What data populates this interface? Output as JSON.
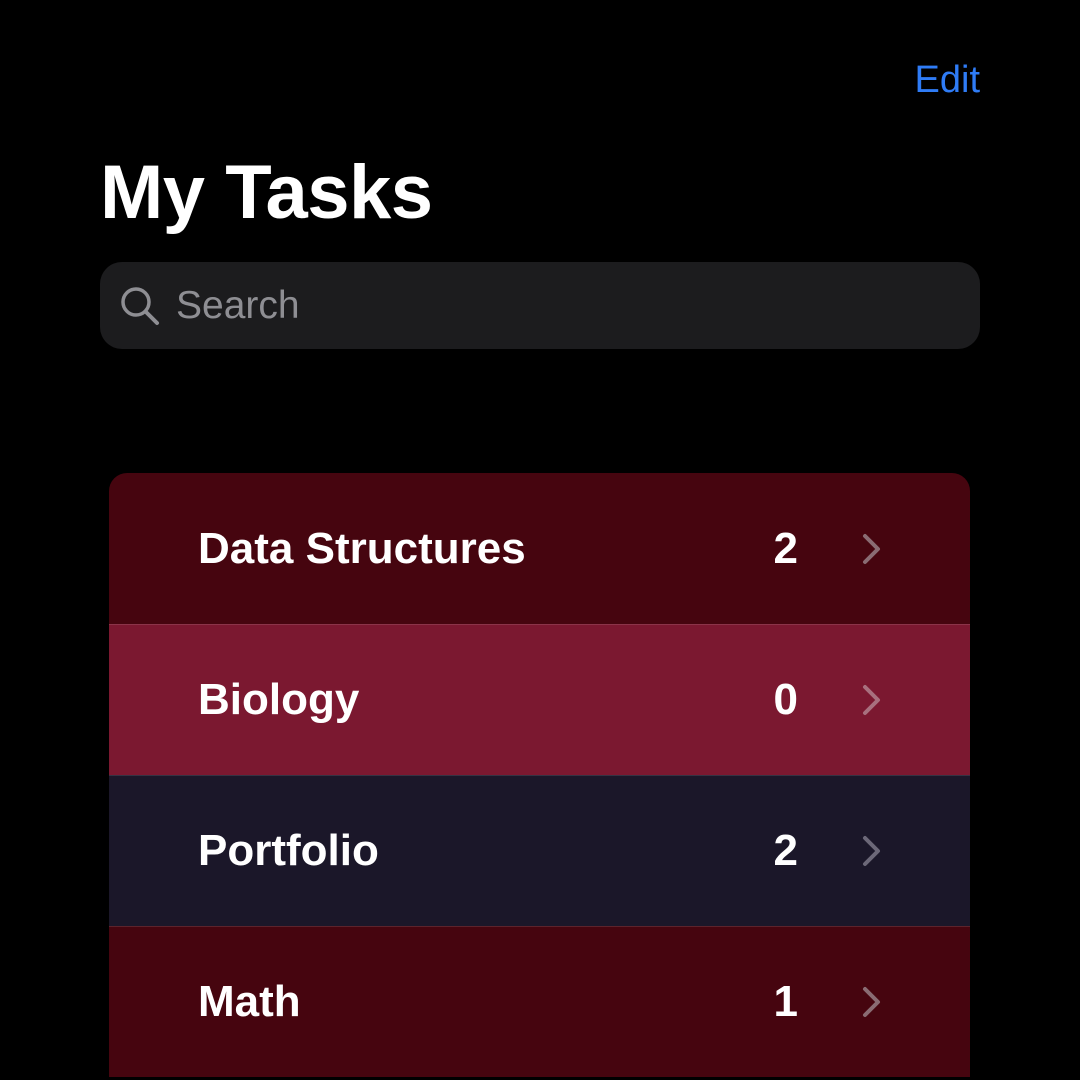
{
  "header": {
    "edit_label": "Edit",
    "title": "My Tasks"
  },
  "search": {
    "placeholder": "Search",
    "icon": "search-icon"
  },
  "lists": [
    {
      "name": "Data Structures",
      "count": "2",
      "color": "#46050f"
    },
    {
      "name": "Biology",
      "count": "0",
      "color": "#7b1830"
    },
    {
      "name": "Portfolio",
      "count": "2",
      "color": "#1b1729"
    },
    {
      "name": "Math",
      "count": "1",
      "color": "#46050f"
    }
  ],
  "colors": {
    "accent": "#2f7cf6",
    "background": "#000000",
    "search_background": "#1c1c1e",
    "chevron": "#8a6c73"
  }
}
